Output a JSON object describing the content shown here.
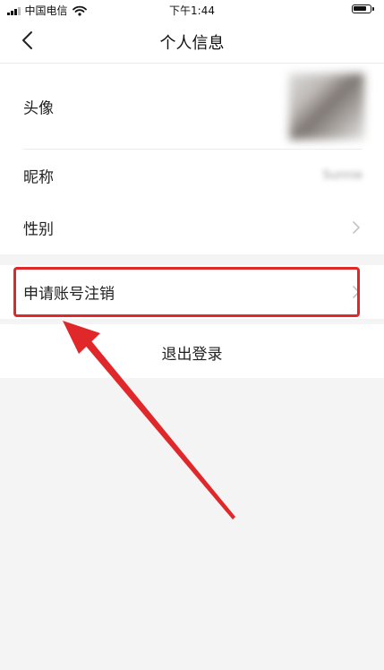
{
  "status_bar": {
    "carrier": "中国电信",
    "time": "下午1:44"
  },
  "nav": {
    "title": "个人信息"
  },
  "profile": {
    "rows": [
      {
        "label": "头像"
      },
      {
        "label": "昵称",
        "value": "Sunnie"
      },
      {
        "label": "性别"
      }
    ]
  },
  "account": {
    "deactivate_label": "申请账号注销"
  },
  "logout": {
    "label": "退出登录"
  },
  "annotation": {
    "color": "#e0282b"
  }
}
